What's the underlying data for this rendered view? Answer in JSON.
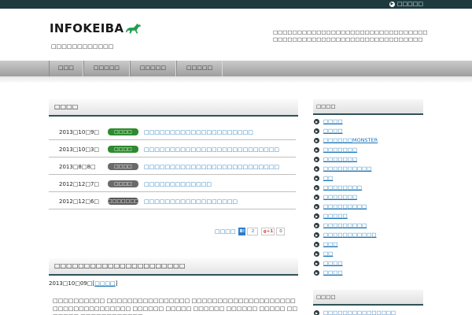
{
  "topbar": {
    "link_label": "□□□□□"
  },
  "header": {
    "logo_text": "INFOKEIBA",
    "tagline": "□□□□□□□□□□□□",
    "description": "□□□□□□□□□□□□□□□□□□□□□□□□□□□□□□□□□□□□□□□□□□□□□□□□□□□□□□□□□□□□□□□"
  },
  "nav": {
    "items": [
      "□□□",
      "□□□□□",
      "□□□□□",
      "□□□□□"
    ]
  },
  "news": {
    "title": "□□□□",
    "items": [
      {
        "date": "2013□10□9□",
        "badge": "□□□□",
        "badge_color": "#2e8b2e",
        "title": "□□□□□□□□□□□□□□□□□□□□□"
      },
      {
        "date": "2013□10□3□",
        "badge": "□□□□",
        "badge_color": "#2e8b2e",
        "title": "□□□□□□□□□□□□□□□□□□□□□□□□□□"
      },
      {
        "date": "2013□8□8□",
        "badge": "□□□□",
        "badge_color": "#6a6a6a",
        "title": "□□□□□□□□□□□□□□□□□□□□□□□□□□"
      },
      {
        "date": "2012□12□7□",
        "badge": "□□□□",
        "badge_color": "#6a6a6a",
        "title": "□□□□□□□□□□□□□"
      },
      {
        "date": "2012□12□6□",
        "badge": "□□□□□□□□",
        "badge_color": "#5a5a5a",
        "title": "□□□□□□□□□□□□□□□□□□"
      }
    ]
  },
  "share": {
    "label": "□□□□",
    "hatena_label": "B!",
    "hatena_count": "2",
    "gplus_label": "g+1",
    "gplus_count": "0"
  },
  "article": {
    "title": "□□□□□□□□□□□□□□□□□□□□□□",
    "date_text": "2013□10□09□",
    "category": "□□□□",
    "body": "□□□□□□□□□□ □□□□□□□□□□□□□□□□ □□□□□□□□□□□□□□□□□□□□□□□□□□□□□□□□□□□ □□□□□□ □□□□□ □□□□□□ □□□□□□ □□□□□ □□□□□□□ □□□□□□□□□□□□"
  },
  "sidebar": {
    "heading1": "□□□□",
    "items": [
      "□□□□",
      "□□□□",
      "□□□□□□MONSTER",
      "□□□□□□□",
      "□□□□□□□",
      "□□□□□□□□□□",
      "□□",
      "□□□□□□□□",
      "□□□□□□□",
      "□□□□□□□□□",
      "□□□□□",
      "□□□□□□□□□",
      "□□□□□□□□□□□",
      "□□□",
      "□□",
      "□□□□",
      "□□□□"
    ],
    "heading2": "□□□□",
    "items2": [
      "□□□□□□□□□□□□□□□"
    ]
  },
  "colors": {
    "accent": "#2e5257",
    "topbar": "#1e3a3f",
    "link": "#1a75b8",
    "logo_horse": "#1e9e4a"
  }
}
